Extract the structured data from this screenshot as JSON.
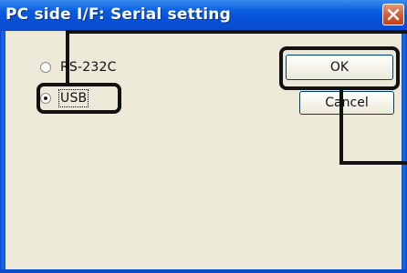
{
  "dialog": {
    "title": "PC side I/F: Serial setting",
    "close_glyph": "✕"
  },
  "options": [
    {
      "label": "RS-232C",
      "selected": false
    },
    {
      "label": "USB",
      "selected": true
    }
  ],
  "buttons": {
    "ok_label": "OK",
    "cancel_label": "Cancel"
  },
  "colors": {
    "titlebar": "#0851d8",
    "face": "#ece9d8",
    "callout": "#111111"
  }
}
